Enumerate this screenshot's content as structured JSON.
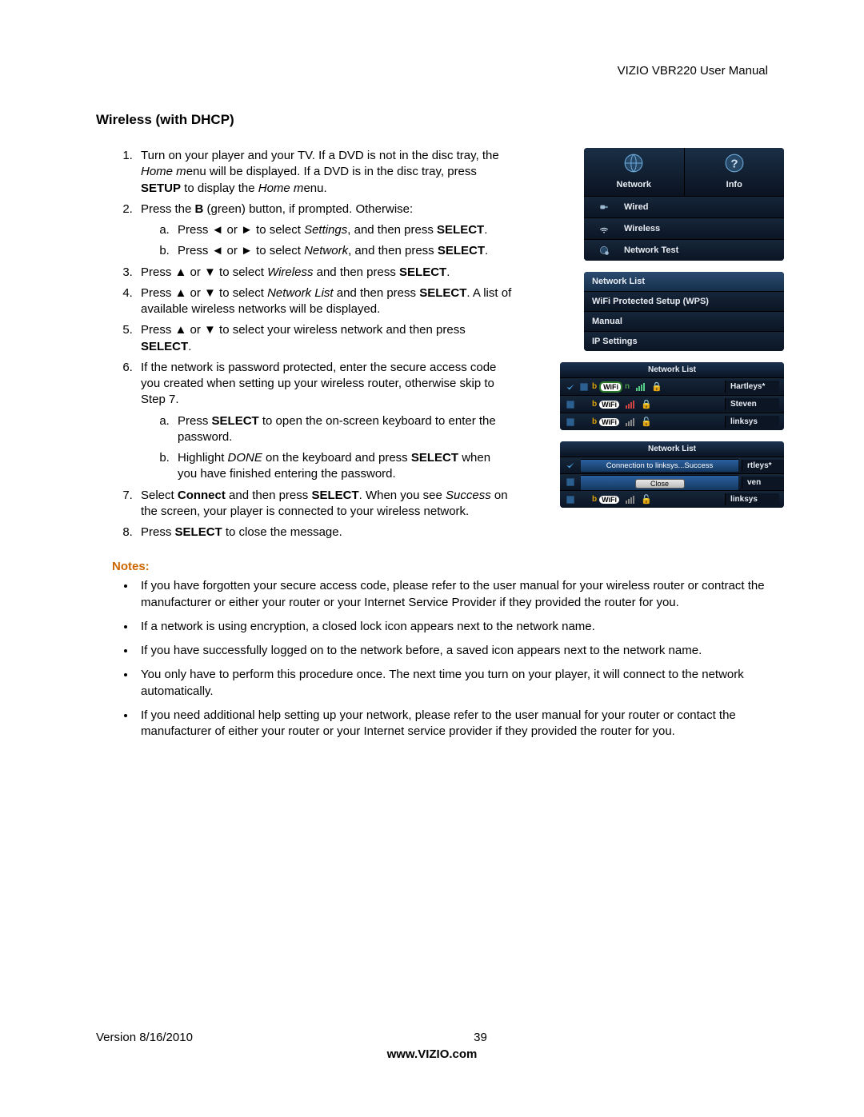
{
  "header": {
    "right": "VIZIO VBR220 User Manual"
  },
  "heading": "Wireless (with DHCP)",
  "steps": {
    "s1a": "Turn on your player and your TV. If a DVD is not in the disc tray, the ",
    "s1b": "Home m",
    "s1c": "enu will be displayed. If a DVD is in the disc tray, press ",
    "s1d": "SETUP",
    "s1e": " to display the ",
    "s1f": "Home m",
    "s1g": "enu.",
    "s2a": "Press the ",
    "s2b": "B",
    "s2c": " (green) button, if prompted. Otherwise:",
    "s2aa1": "Press ◄ or ► to select ",
    "s2aa2": "Settings",
    "s2aa3": ", and then press ",
    "s2aa4": "SELECT",
    "s2aa5": ".",
    "s2bb1": "Press ◄ or ► to select ",
    "s2bb2": "Network",
    "s2bb3": ", and then press ",
    "s2bb4": "SELECT",
    "s2bb5": ".",
    "s3a": "Press ▲ or ▼ to select ",
    "s3b": "Wireless",
    "s3c": " and then press ",
    "s3d": "SELECT",
    "s3e": ".",
    "s4a": "Press ▲ or ▼ to select ",
    "s4b": "Network List",
    "s4c": " and then press ",
    "s4d": "SELECT",
    "s4e": ". A list of available wireless networks will be displayed.",
    "s5a": "Press ▲ or ▼ to select your wireless network and then press ",
    "s5b": "SELECT",
    "s5c": ".",
    "s6": "If the network is password protected, enter the secure access code you created when setting up your wireless router, otherwise skip to Step 7.",
    "s6a1": "Press ",
    "s6a2": "SELECT",
    "s6a3": " to open the on-screen keyboard to enter the password.",
    "s6b1": "Highlight ",
    "s6b2": "DONE",
    "s6b3": " on the keyboard and press ",
    "s6b4": "SELECT",
    "s6b5": " when you have finished entering the password.",
    "s7a": "Select ",
    "s7b": "Connect",
    "s7c": " and then press ",
    "s7d": "SELECT",
    "s7e": ". When you see ",
    "s7f": "Success",
    "s7g": " on the screen, your player is connected to your wireless network.",
    "s8a": "Press ",
    "s8b": "SELECT",
    "s8c": " to close the message."
  },
  "notes_heading": "Notes:",
  "notes": [
    "If you have forgotten your secure access code, please refer to the user manual for your wireless router or contract the manufacturer or either your router or your Internet Service Provider if they provided the router for you.",
    "If a network is using encryption, a closed lock icon appears next to the network name.",
    "If you have successfully logged on to the network before, a saved icon appears next to the network name.",
    "You only have to perform this procedure once. The next time you turn on your player, it will connect to the network automatically.",
    "If you need additional help setting up your network, please refer to the user manual for your router or contact the manufacturer of either your router or your Internet service provider if they provided the router for you."
  ],
  "fig1": {
    "tab_network": "Network",
    "tab_info": "Info",
    "wired": "Wired",
    "wireless": "Wireless",
    "network_test": "Network Test"
  },
  "fig2": {
    "network_list": "Network List",
    "wps": "WiFi Protected Setup (WPS)",
    "manual": "Manual",
    "ip_settings": "IP Settings"
  },
  "fig3": {
    "title": "Network List",
    "wifi_badge": "WiFi",
    "n1": "Hartleys*",
    "n2": "Steven",
    "n3": "linksys"
  },
  "fig4": {
    "title": "Network List",
    "msg": "Connection to  linksys...Success",
    "close": "Close",
    "tail1": "rtleys*",
    "tail2": "ven",
    "wifi_badge": "WiFi",
    "n3": "linksys"
  },
  "footer": {
    "version": "Version 8/16/2010",
    "page": "39",
    "site": "www.VIZIO.com"
  }
}
